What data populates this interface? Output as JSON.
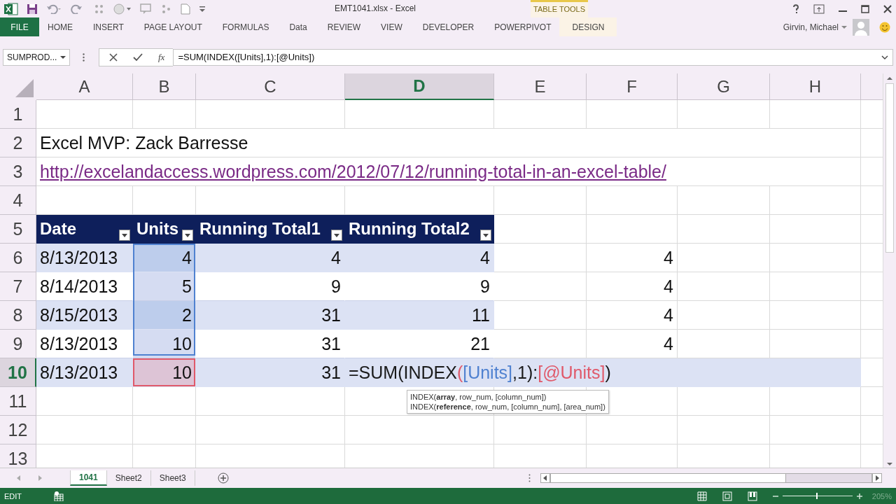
{
  "window": {
    "title": "EMT1041.xlsx - Excel",
    "context_label": "TABLE TOOLS",
    "user": "Girvin, Michael"
  },
  "ribbon_tabs": [
    {
      "label": "FILE",
      "kind": "file",
      "selected": false
    },
    {
      "label": "HOME",
      "kind": "normal",
      "selected": false
    },
    {
      "label": "INSERT",
      "kind": "normal",
      "selected": false
    },
    {
      "label": "PAGE LAYOUT",
      "kind": "normal",
      "selected": false
    },
    {
      "label": "FORMULAS",
      "kind": "normal",
      "selected": false
    },
    {
      "label": "Data",
      "kind": "normal",
      "selected": false
    },
    {
      "label": "REVIEW",
      "kind": "normal",
      "selected": false
    },
    {
      "label": "VIEW",
      "kind": "normal",
      "selected": false
    },
    {
      "label": "DEVELOPER",
      "kind": "normal",
      "selected": false
    },
    {
      "label": "POWERPIVOT",
      "kind": "normal",
      "selected": false
    },
    {
      "label": "DESIGN",
      "kind": "contextual",
      "selected": false
    }
  ],
  "formula_bar": {
    "name_box": "SUMPROD...",
    "fx": "fx",
    "formula": "=SUM(INDEX([Units],1):[@Units])"
  },
  "columns": [
    {
      "label": "A",
      "selected": false
    },
    {
      "label": "B",
      "selected": false
    },
    {
      "label": "C",
      "selected": false
    },
    {
      "label": "D",
      "selected": true
    },
    {
      "label": "E",
      "selected": false
    },
    {
      "label": "F",
      "selected": false
    },
    {
      "label": "G",
      "selected": false
    },
    {
      "label": "H",
      "selected": false
    }
  ],
  "rows": [
    {
      "label": "1",
      "selected": false
    },
    {
      "label": "2",
      "selected": false,
      "cells": [
        {
          "text": "Excel MVP: Zack Barresse",
          "kind": "text"
        },
        null,
        null,
        null,
        null,
        null,
        null,
        null
      ]
    },
    {
      "label": "3",
      "selected": false,
      "cells": [
        {
          "text": "http://excelandaccess.wordpress.com/2012/07/12/running-total-in-an-excel-table/",
          "kind": "link"
        },
        null,
        null,
        null,
        null,
        null,
        null,
        null
      ]
    },
    {
      "label": "4",
      "selected": false
    },
    {
      "label": "5",
      "selected": false,
      "cells": [
        {
          "text": "Date",
          "kind": "header",
          "filter": true
        },
        {
          "text": "Units",
          "kind": "header",
          "filter": true
        },
        {
          "text": "Running Total1",
          "kind": "header",
          "filter": true
        },
        {
          "text": "Running Total2",
          "kind": "header",
          "filter": true
        },
        null,
        null,
        null,
        null
      ]
    },
    {
      "label": "6",
      "selected": false,
      "banded": true,
      "cells": [
        {
          "text": "8/13/2013",
          "kind": "text",
          "table": true
        },
        {
          "text": "4",
          "kind": "number",
          "table": true,
          "color": "#4f81d0"
        },
        {
          "text": "4",
          "kind": "number",
          "table": true
        },
        {
          "text": "4",
          "kind": "number",
          "table": true
        },
        null,
        {
          "text": "4",
          "kind": "number"
        },
        null,
        null
      ]
    },
    {
      "label": "7",
      "selected": false,
      "banded": false,
      "cells": [
        {
          "text": "8/14/2013",
          "kind": "text",
          "table": true
        },
        {
          "text": "5",
          "kind": "number",
          "table": true,
          "color": "#4f81d0"
        },
        {
          "text": "9",
          "kind": "number",
          "table": true
        },
        {
          "text": "9",
          "kind": "number",
          "table": true
        },
        null,
        {
          "text": "4",
          "kind": "number"
        },
        null,
        null
      ]
    },
    {
      "label": "8",
      "selected": false,
      "banded": true,
      "cells": [
        {
          "text": "8/15/2013",
          "kind": "text",
          "table": true
        },
        {
          "text": "2",
          "kind": "number",
          "table": true,
          "color": "#4f81d0"
        },
        {
          "text": "31",
          "kind": "number",
          "table": true
        },
        {
          "text": "11",
          "kind": "number",
          "table": true
        },
        null,
        {
          "text": "4",
          "kind": "number"
        },
        null,
        null
      ]
    },
    {
      "label": "9",
      "selected": false,
      "banded": false,
      "cells": [
        {
          "text": "8/13/2013",
          "kind": "text",
          "table": true
        },
        {
          "text": "10",
          "kind": "number",
          "table": true,
          "color": "#4f81d0"
        },
        {
          "text": "31",
          "kind": "number",
          "table": true
        },
        {
          "text": "21",
          "kind": "number",
          "table": true
        },
        null,
        {
          "text": "4",
          "kind": "number"
        },
        null,
        null
      ]
    },
    {
      "label": "10",
      "selected": true,
      "banded": true,
      "cells": [
        {
          "text": "8/13/2013",
          "kind": "text",
          "table": true
        },
        {
          "text": "10",
          "kind": "number",
          "table": true,
          "color": "#e0596a"
        },
        {
          "text": "31",
          "kind": "number",
          "table": true
        },
        {
          "kind": "formula",
          "table": true,
          "parts": [
            {
              "text": "=SUM(INDEX",
              "color": "#1a1a1a"
            },
            {
              "text": "(",
              "color": "#e0596a"
            },
            {
              "text": "[Units]",
              "color": "#4f81d0"
            },
            {
              "text": ",1)",
              "color": "#1a1a1a"
            },
            {
              "text": ":",
              "color": "#1a1a1a"
            },
            {
              "text": "[@Units]",
              "color": "#e0596a"
            },
            {
              "text": ")",
              "color": "#1a1a1a"
            }
          ]
        },
        null,
        null,
        null,
        null
      ]
    },
    {
      "label": "11",
      "selected": false
    },
    {
      "label": "12",
      "selected": false
    },
    {
      "label": "13",
      "selected": false
    }
  ],
  "tooltip": [
    "INDEX(**array**, row_num, [column_num])",
    "INDEX(**reference**, row_num, [column_num], [area_num])"
  ],
  "sheet_tabs": [
    {
      "label": "1041",
      "selected": true
    },
    {
      "label": "Sheet2",
      "selected": false
    },
    {
      "label": "Sheet3",
      "selected": false
    }
  ],
  "status_bar": {
    "mode": "EDIT",
    "zoom": "205%"
  },
  "zoom_slider": {
    "level": 0.5
  }
}
